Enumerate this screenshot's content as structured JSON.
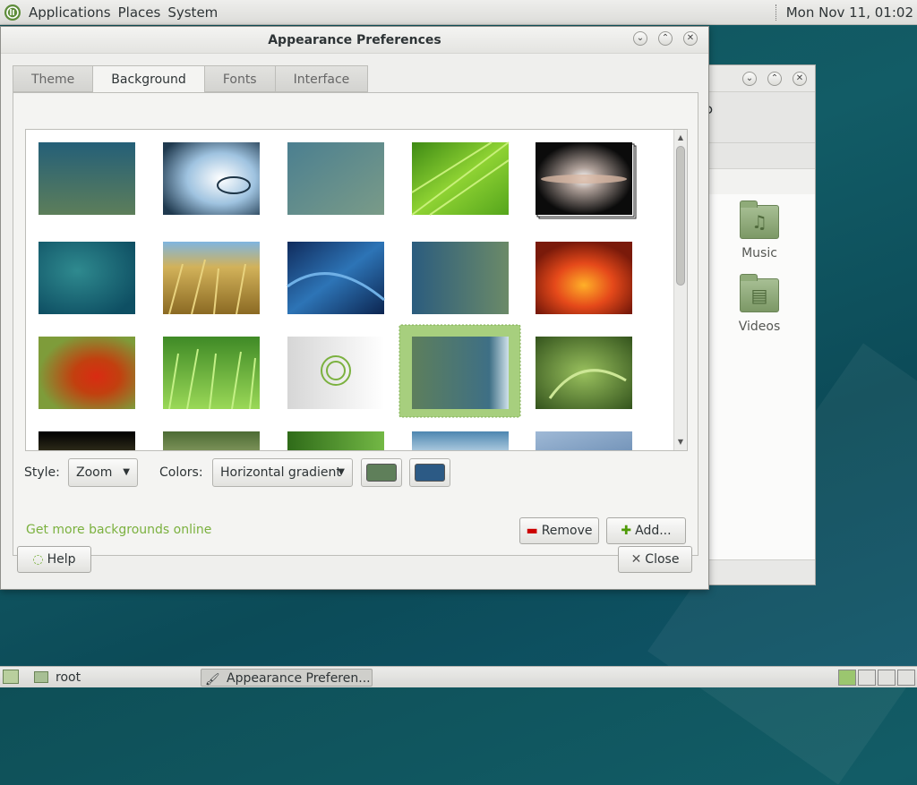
{
  "top_panel": {
    "menus": [
      "Applications",
      "Places",
      "System"
    ],
    "clock": "Mon Nov 11, 01:02"
  },
  "background_window": {
    "folders": [
      {
        "label": "Music",
        "icon": "music-folder-icon"
      },
      {
        "label": "Videos",
        "icon": "videos-folder-icon"
      }
    ]
  },
  "dialog": {
    "title": "Appearance Preferences",
    "tabs": [
      "Theme",
      "Background",
      "Fonts",
      "Interface"
    ],
    "active_tab": "Background",
    "gallery": {
      "selected_index": 13
    },
    "style_label": "Style:",
    "style_value": "Zoom",
    "colors_label": "Colors:",
    "colors_value": "Horizontal gradient",
    "primary_color": "#5f7f5a",
    "secondary_color": "#2c5a85",
    "more_link": "Get more backgrounds online",
    "remove_label": "Remove",
    "add_label": "Add...",
    "help_label": "Help",
    "close_label": "Close"
  },
  "taskbar": {
    "tasks": [
      {
        "label": "root",
        "icon": "folder-icon"
      },
      {
        "label": "Appearance Preferen...",
        "icon": "appearance-icon"
      }
    ],
    "workspaces": 4,
    "current_workspace": 1
  },
  "colors": {
    "accent": "#7bb13f",
    "selection": "#a7cf7e"
  }
}
